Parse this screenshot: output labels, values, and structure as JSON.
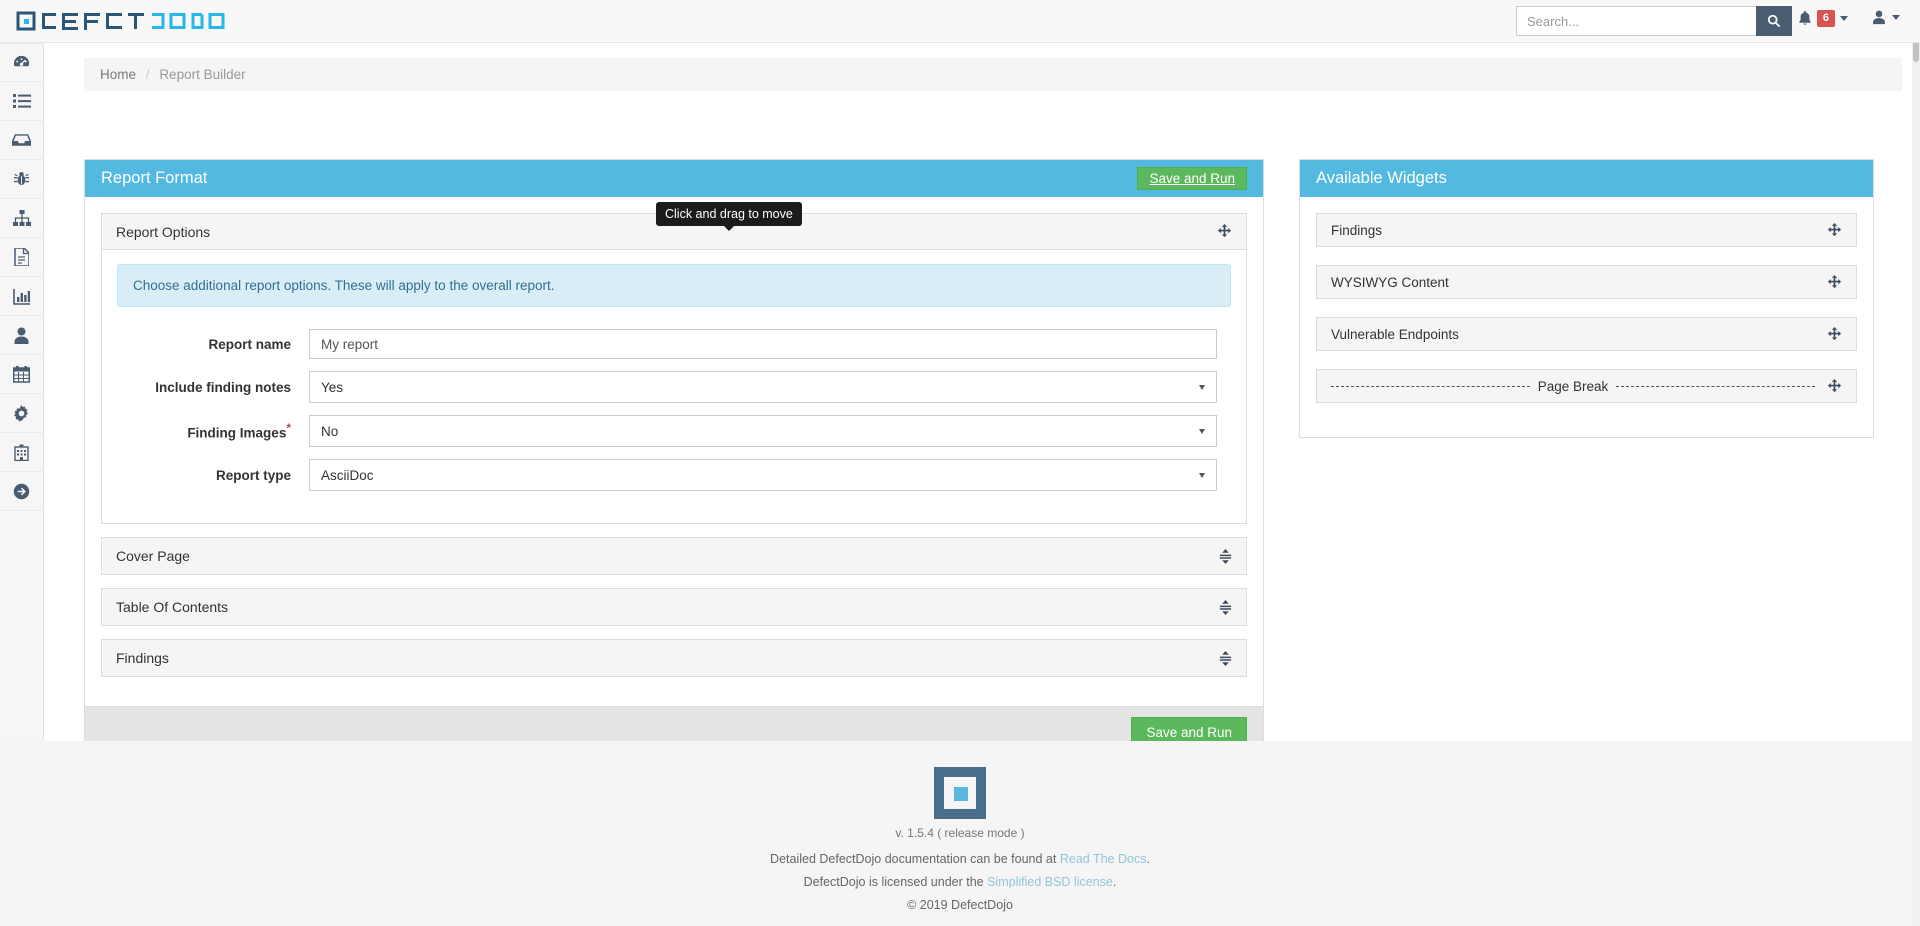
{
  "app": {
    "brand_dark": "#2b5676",
    "brand_light": "#29b6e8",
    "logo_text_1": "DEFECT",
    "logo_text_2": "DOJO"
  },
  "topbar": {
    "search_placeholder": "Search...",
    "search_value": "",
    "notification_count": "6"
  },
  "sidebar": {
    "items": [
      {
        "icon": "dashboard-icon",
        "label": "Dashboard"
      },
      {
        "icon": "list-icon",
        "label": "Findings"
      },
      {
        "icon": "inbox-icon",
        "label": "Engagements"
      },
      {
        "icon": "bug-icon",
        "label": "Products"
      },
      {
        "icon": "sitemap-icon",
        "label": "Endpoints"
      },
      {
        "icon": "file-text-icon",
        "label": "Reports"
      },
      {
        "icon": "bar-chart-icon",
        "label": "Metrics"
      },
      {
        "icon": "user-icon",
        "label": "Users"
      },
      {
        "icon": "calendar-icon",
        "label": "Calendar"
      },
      {
        "icon": "gear-icon",
        "label": "Configuration"
      },
      {
        "icon": "building-icon",
        "label": "Product Types"
      },
      {
        "icon": "arrow-circle-right-icon",
        "label": "Logout"
      }
    ]
  },
  "breadcrumb": {
    "home": "Home",
    "separator": "/",
    "current": "Report Builder"
  },
  "report_format": {
    "title": "Report Format",
    "header_save_label": "Save and Run",
    "footer_save_label": "Save and Run",
    "tooltip": "Click and drag to move",
    "options_section": {
      "title": "Report Options",
      "alert": "Choose additional report options. These will apply to the overall report.",
      "fields": [
        {
          "label": "Report name",
          "type": "text",
          "value": "My report",
          "required": false
        },
        {
          "label": "Include finding notes",
          "type": "select",
          "value": "Yes",
          "required": false
        },
        {
          "label": "Finding Images",
          "type": "select",
          "value": "No",
          "required": true
        },
        {
          "label": "Report type",
          "type": "select",
          "value": "AsciiDoc",
          "required": false
        }
      ]
    },
    "sections": [
      {
        "title": "Cover Page"
      },
      {
        "title": "Table Of Contents"
      },
      {
        "title": "Findings"
      }
    ]
  },
  "available_widgets": {
    "title": "Available Widgets",
    "items": [
      {
        "label": "Findings",
        "type": "widget"
      },
      {
        "label": "WYSIWYG Content",
        "type": "widget"
      },
      {
        "label": "Vulnerable Endpoints",
        "type": "widget"
      },
      {
        "label": "Page Break",
        "type": "pagebreak"
      }
    ]
  },
  "footer": {
    "version": "v. 1.5.4 ( release mode )",
    "docs_prefix": "Detailed DefectDojo documentation can be found at ",
    "docs_link": "Read The Docs",
    "docs_suffix": ".",
    "license_prefix": "DefectDojo is licensed under the ",
    "license_link": "Simplified BSD license",
    "license_suffix": ".",
    "copyright": "© 2019 DefectDojo"
  }
}
